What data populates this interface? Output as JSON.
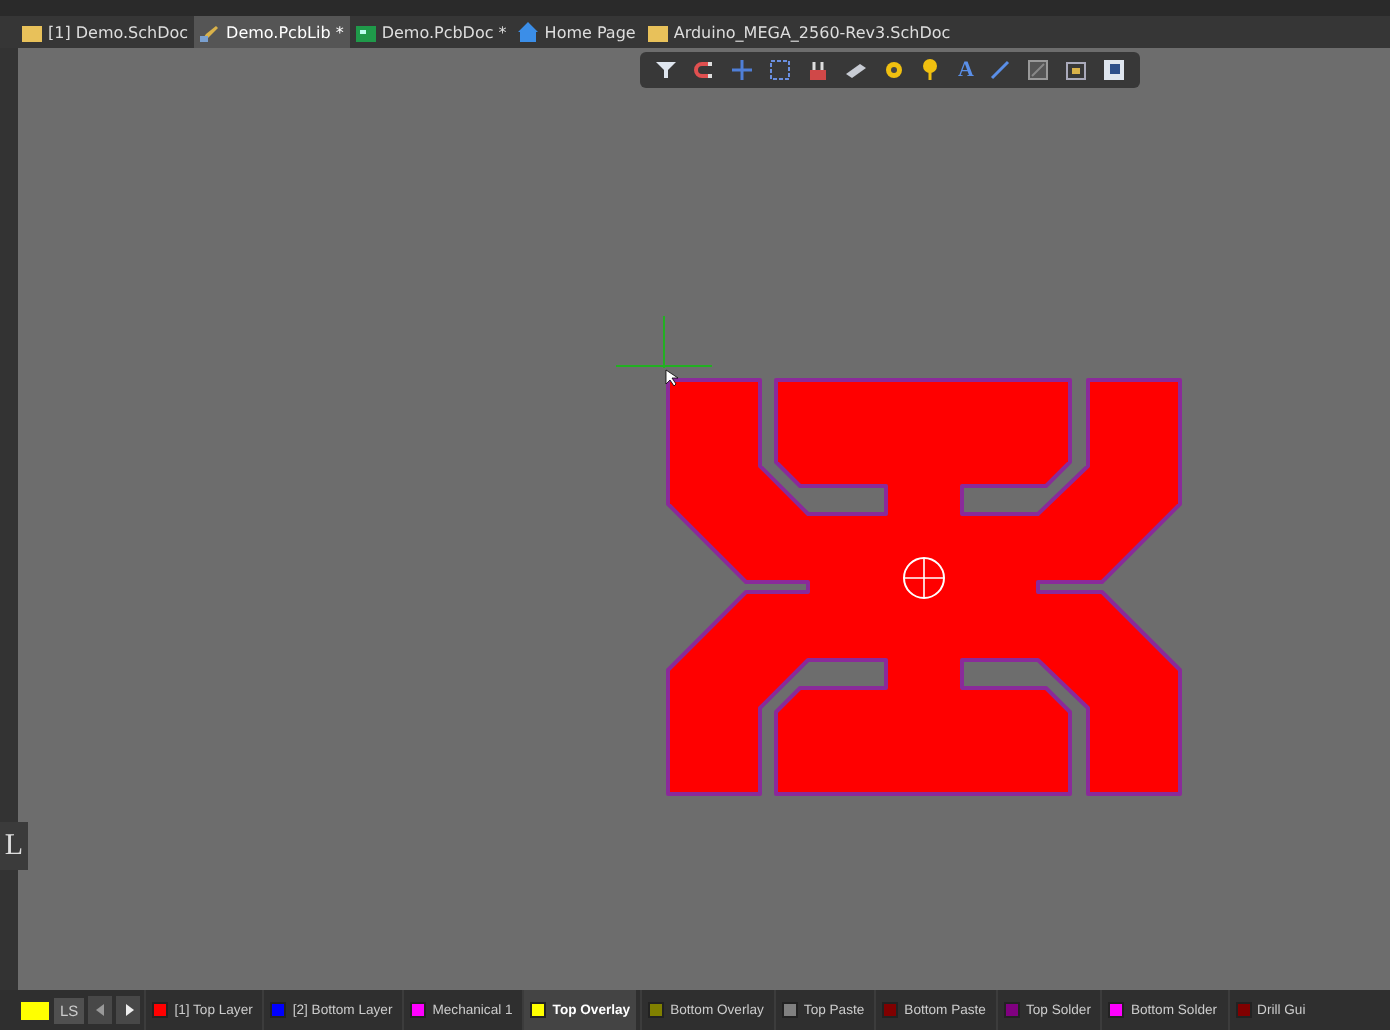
{
  "tabs": [
    {
      "label": "[1] Demo.SchDoc",
      "kind": "sch",
      "selected": false
    },
    {
      "label": "Demo.PcbLib *",
      "kind": "lib",
      "selected": true
    },
    {
      "label": "Demo.PcbDoc *",
      "kind": "pcb",
      "selected": false
    },
    {
      "label": "Home Page",
      "kind": "home",
      "selected": false
    },
    {
      "label": "Arduino_MEGA_2560-Rev3.SchDoc",
      "kind": "sch",
      "selected": false
    }
  ],
  "toolbar": [
    {
      "kind": "funnel"
    },
    {
      "kind": "magnet"
    },
    {
      "kind": "cross"
    },
    {
      "kind": "select"
    },
    {
      "kind": "component"
    },
    {
      "kind": "track"
    },
    {
      "kind": "pad"
    },
    {
      "kind": "via"
    },
    {
      "kind": "text",
      "label": "A"
    },
    {
      "kind": "line"
    },
    {
      "kind": "fill"
    },
    {
      "kind": "frame"
    },
    {
      "kind": "region"
    }
  ],
  "side_button": {
    "label": "L"
  },
  "layer_bar": {
    "current_layer": {
      "color": "#ffff00"
    },
    "ls_label": "LS",
    "layers": [
      {
        "label": "[1] Top Layer",
        "color": "#ff0000",
        "selected": false
      },
      {
        "label": "[2] Bottom Layer",
        "color": "#0000ff",
        "selected": false
      },
      {
        "label": "Mechanical 1",
        "color": "#ff00ff",
        "selected": false
      },
      {
        "label": "Top Overlay",
        "color": "#ffff00",
        "selected": true
      },
      {
        "label": "Bottom Overlay",
        "color": "#808000",
        "selected": false
      },
      {
        "label": "Top Paste",
        "color": "#808080",
        "selected": false
      },
      {
        "label": "Bottom Paste",
        "color": "#800000",
        "selected": false
      },
      {
        "label": "Top Solder",
        "color": "#800080",
        "selected": false
      },
      {
        "label": "Bottom Solder",
        "color": "#ff00ff",
        "selected": false
      },
      {
        "label": "Drill Gui",
        "color": "#800000",
        "selected": false
      }
    ]
  }
}
